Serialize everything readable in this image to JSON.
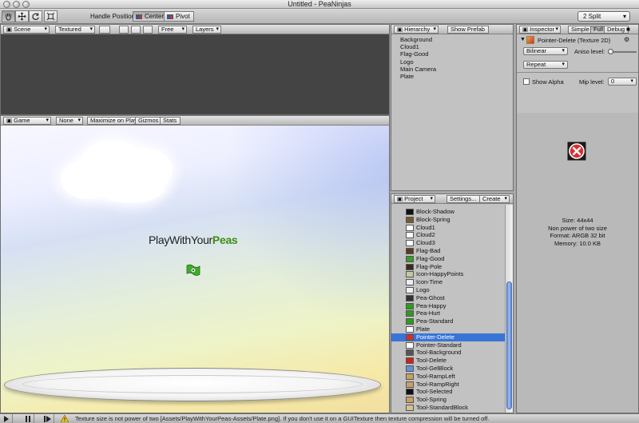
{
  "window": {
    "title": "Untitled - PeaNinjas"
  },
  "toolbar": {
    "handle_position_label": "Handle Position:",
    "center_label": "Center",
    "pivot_label": "Pivot",
    "layout_label": "2 Split",
    "tools": [
      "hand-icon",
      "move-icon",
      "rotate-icon",
      "scale-icon"
    ]
  },
  "scene": {
    "tab_label": "Scene",
    "render_mode": "Textured",
    "camera_mode": "Free",
    "layers_label": "Layers"
  },
  "game": {
    "tab_label": "Game",
    "aspect_label": "None",
    "maximize_label": "Maximize on Play",
    "gizmos_label": "Gizmos",
    "stats_label": "Stats",
    "logo_prefix": "PlayWithYour",
    "logo_highlight": "Peas"
  },
  "hierarchy": {
    "tab_label": "Hierarchy",
    "show_prefab_label": "Show Prefab",
    "items": [
      "Background",
      "Cloud1",
      "Flag-Good",
      "Logo",
      "Main Camera",
      "Plate"
    ]
  },
  "project": {
    "tab_label": "Project",
    "settings_label": "Settings...",
    "create_label": "Create",
    "items": [
      {
        "label": "Block-Shadow",
        "icon": "#111111"
      },
      {
        "label": "Block-Spring",
        "icon": "#7a5a2a"
      },
      {
        "label": "Cloud1",
        "icon": "#ffffff"
      },
      {
        "label": "Cloud2",
        "icon": "#ffffff"
      },
      {
        "label": "Cloud3",
        "icon": "#ffffff"
      },
      {
        "label": "Flag-Bad",
        "icon": "#5a3a22"
      },
      {
        "label": "Flag-Good",
        "icon": "#3a9a2a"
      },
      {
        "label": "Flag-Pole",
        "icon": "#3b2a1a"
      },
      {
        "label": "Icon-HappyPoints",
        "icon": "#c8c8a0"
      },
      {
        "label": "Icon-Time",
        "icon": "#eeeeee"
      },
      {
        "label": "Logo",
        "icon": "#f0f0f0"
      },
      {
        "label": "Pea-Ghost",
        "icon": "#333333"
      },
      {
        "label": "Pea-Happy",
        "icon": "#2f9a1f"
      },
      {
        "label": "Pea-Hurt",
        "icon": "#2f9a1f"
      },
      {
        "label": "Pea-Standard",
        "icon": "#2f9a1f"
      },
      {
        "label": "Plate",
        "icon": "#ffffff"
      },
      {
        "label": "Pointer-Delete",
        "icon": "#d03030"
      },
      {
        "label": "Pointer-Standard",
        "icon": "#ffffff"
      },
      {
        "label": "Tool-Background",
        "icon": "#555555"
      },
      {
        "label": "Tool-Delete",
        "icon": "#cc2222"
      },
      {
        "label": "Tool-GelBlock",
        "icon": "#6a8fd6"
      },
      {
        "label": "Tool-RampLeft",
        "icon": "#c8a060"
      },
      {
        "label": "Tool-RampRight",
        "icon": "#c8a060"
      },
      {
        "label": "Tool-Selected",
        "icon": "#111111"
      },
      {
        "label": "Tool-Spring",
        "icon": "#c8a060"
      },
      {
        "label": "Tool-StandardBlock",
        "icon": "#d8c090"
      }
    ],
    "selected": "Pointer-Delete"
  },
  "inspector": {
    "tab_label": "Inspector",
    "simple_label": "Simple",
    "full_label": "Full",
    "debug_label": "Debug",
    "asset_title": "Pointer-Delete (Texture 2D)",
    "filter_mode": "Bilinear",
    "aniso_label": "Aniso level:",
    "wrap_mode": "Repeat",
    "show_alpha_label": "Show Alpha",
    "mip_label": "Mip level:",
    "mip_value": "0",
    "info": {
      "size": "Size: 44x44",
      "npot": "Non power of two size",
      "format": "Format: ARGB 32 bit",
      "memory": "Memory: 10.0 KB"
    }
  },
  "status": {
    "message": "Texture size is not power of two [Assets/PlayWithYourPeas-Assets/Plate.png]. If you don't use it on a GUITexture then texture compression will be turned off."
  }
}
